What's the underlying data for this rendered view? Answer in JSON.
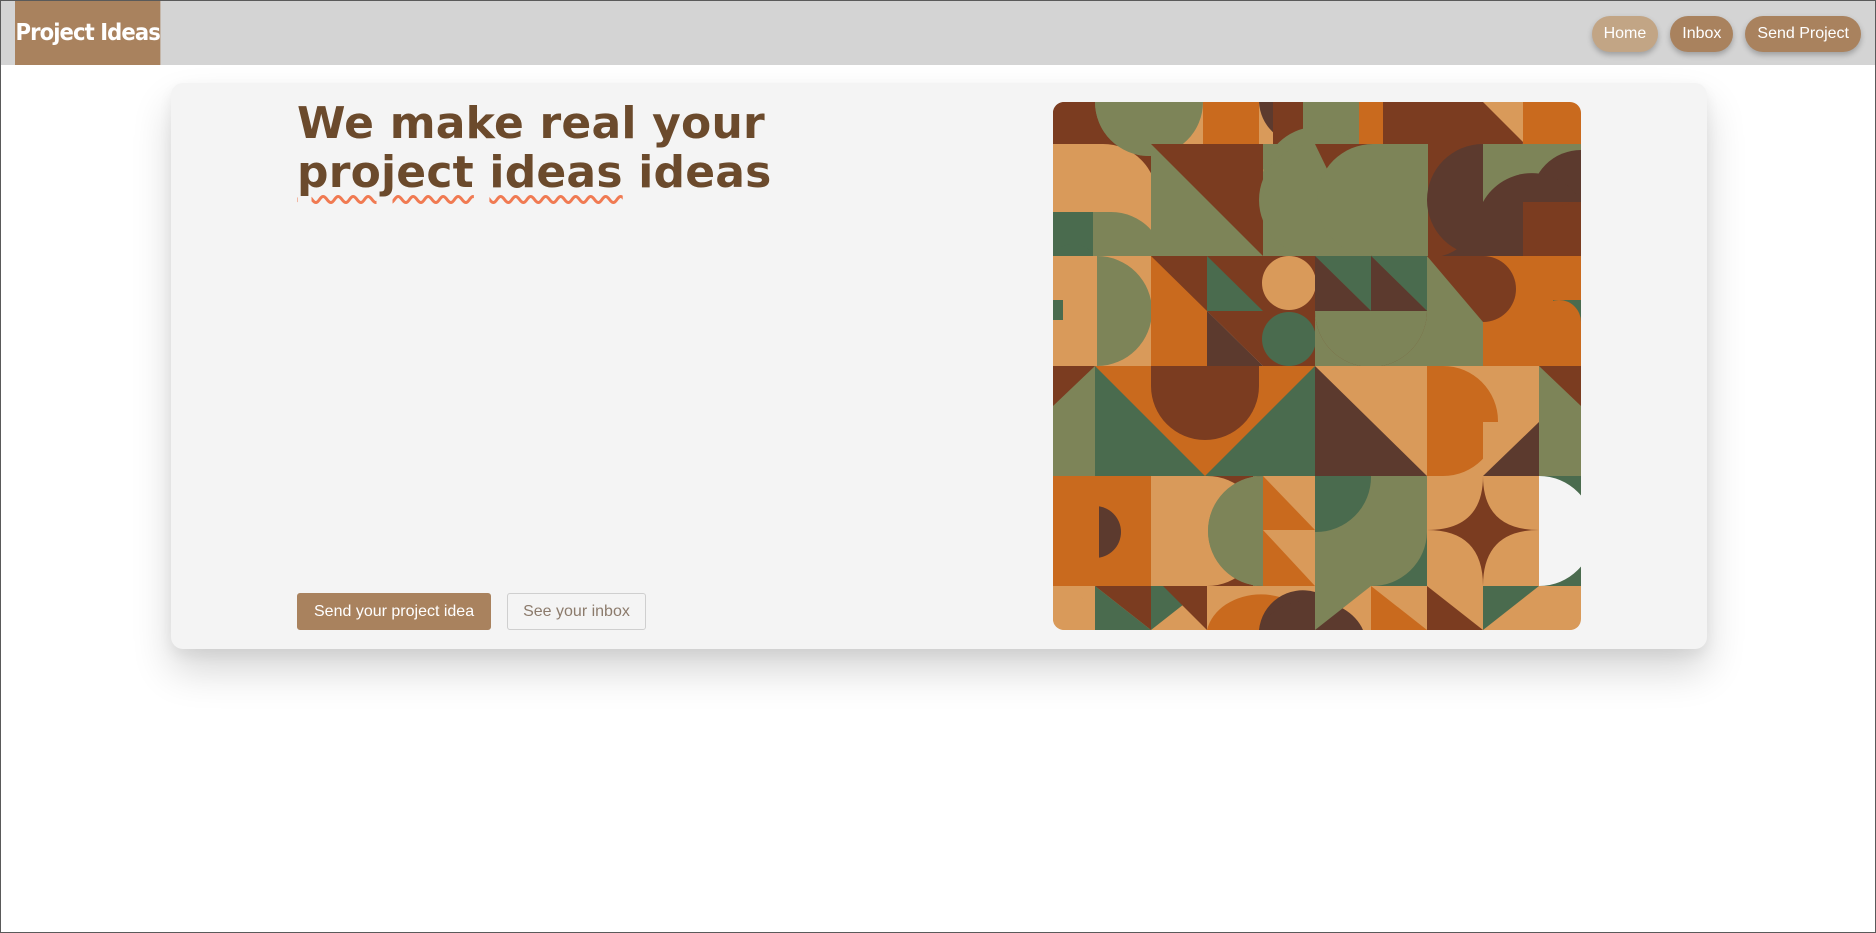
{
  "brand": {
    "title": "Project Ideas"
  },
  "nav": {
    "items": [
      {
        "label": "Home",
        "active": true
      },
      {
        "label": "Inbox",
        "active": false
      },
      {
        "label": "Send Project",
        "active": false
      }
    ]
  },
  "hero": {
    "headline_part1": "We make real your ",
    "headline_squiggle1": "project",
    "headline_part2": " ",
    "headline_squiggle2": "ideas",
    "headline_part3": " ideas",
    "primary_cta": "Send your project idea",
    "secondary_cta": "See your inbox",
    "artwork": "geometric-pattern-illustration"
  },
  "colors": {
    "brand": "#a9825e",
    "brand_light": "#c2a585",
    "topbar": "#d4d4d4",
    "card": "#f4f4f4",
    "headline": "#6b4a2c",
    "squiggle": "#f07a52",
    "art_palette": [
      "#7b3c20",
      "#d99a5a",
      "#c96a1e",
      "#7d8458",
      "#4a6b4e",
      "#5c3a2e"
    ]
  }
}
